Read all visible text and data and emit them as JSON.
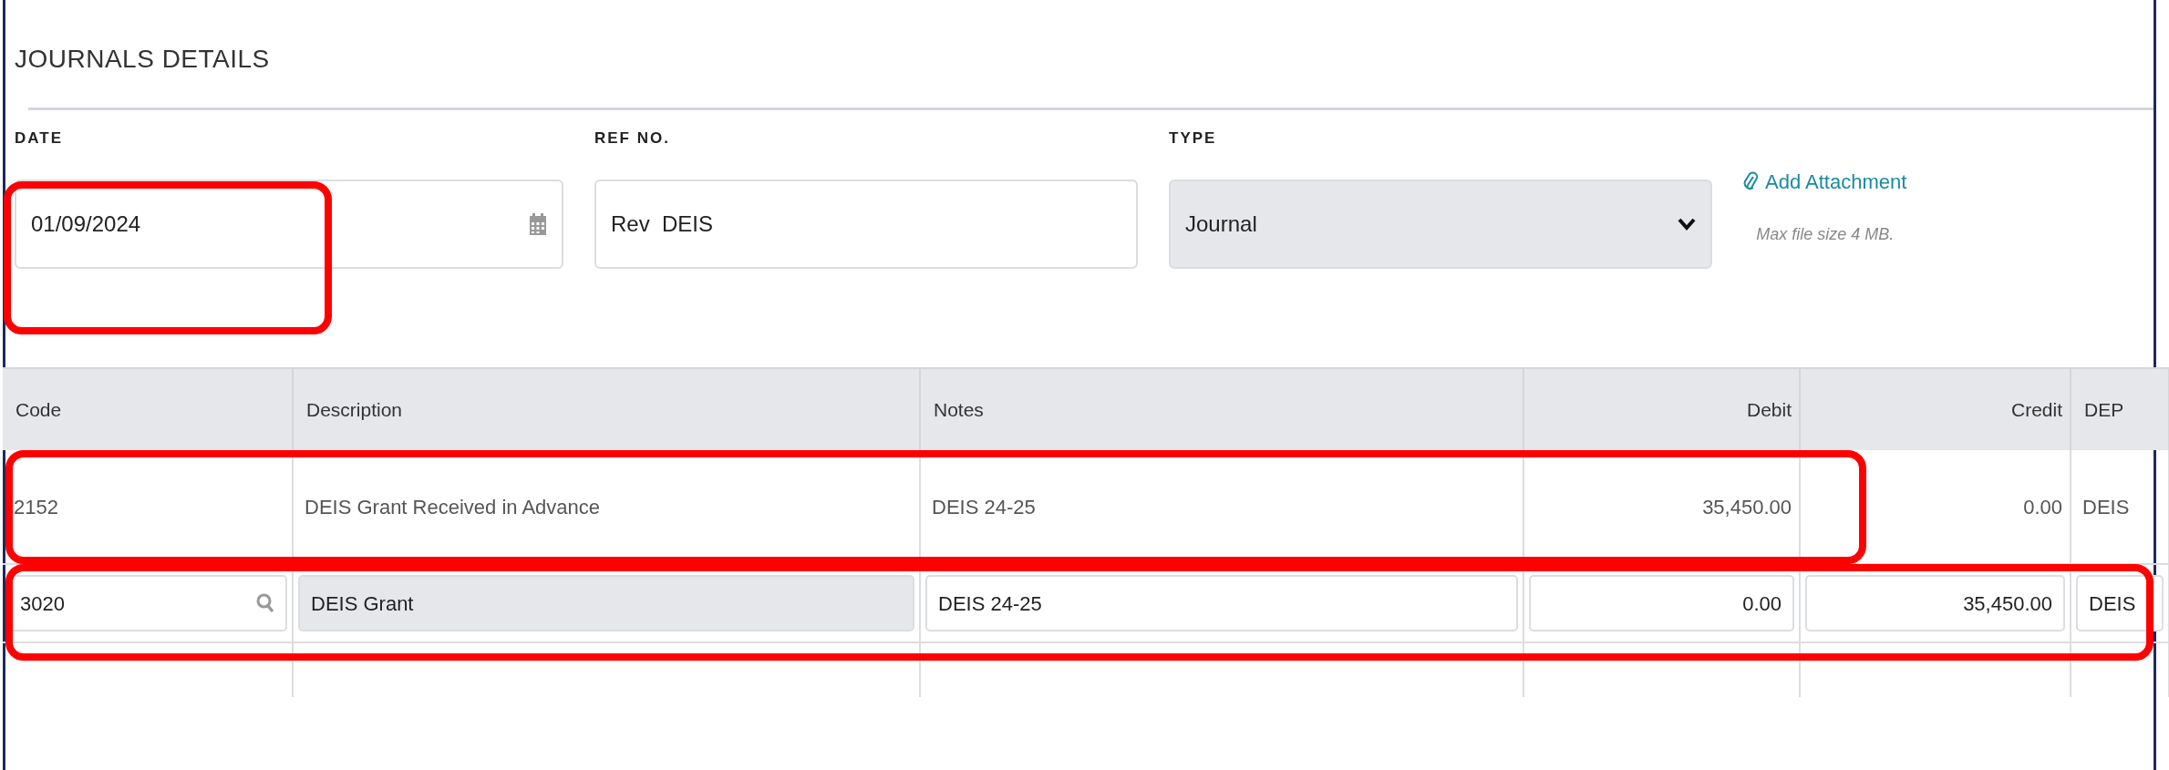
{
  "title": "JOURNALS DETAILS",
  "fields": [
    {
      "kind": "date",
      "label": "DATE",
      "value": "01/09/2024",
      "highlighted": true
    },
    {
      "kind": "text",
      "label": "REF NO.",
      "value": "Rev  DEIS",
      "highlighted": false
    },
    {
      "kind": "select",
      "label": "TYPE",
      "value": "Journal",
      "highlighted": false
    }
  ],
  "attachment": {
    "link": "Add Attachment",
    "hint": "Max file size 4 MB."
  },
  "table": {
    "columns": [
      {
        "label": "Code",
        "kind": "text"
      },
      {
        "label": "Description",
        "kind": "text"
      },
      {
        "label": "Notes",
        "kind": "text"
      },
      {
        "label": "Debit",
        "kind": "amount"
      },
      {
        "label": "Credit",
        "kind": "amount"
      },
      {
        "label": "DEP",
        "kind": "text"
      }
    ],
    "rows": [
      {
        "cells": [
          {
            "kind": "text",
            "text": "2152",
            "highlighted": true
          },
          {
            "kind": "text",
            "text": "DEIS Grant Received in Advance",
            "highlighted": true
          },
          {
            "kind": "text",
            "text": "DEIS 24-25",
            "highlighted": true
          },
          {
            "kind": "text",
            "text": "35,450.00",
            "highlighted": true
          },
          {
            "kind": "text",
            "text": "0.00",
            "highlighted": false
          },
          {
            "kind": "text",
            "text": "DEIS",
            "highlighted": false
          }
        ]
      },
      {
        "cells": [
          {
            "kind": "lookup",
            "text": "3020",
            "highlighted": true
          },
          {
            "kind": "readonly",
            "text": "DEIS Grant",
            "highlighted": true
          },
          {
            "kind": "input",
            "text": "DEIS 24-25",
            "highlighted": true
          },
          {
            "kind": "input",
            "text": "0.00",
            "highlighted": true
          },
          {
            "kind": "input",
            "text": "35,450.00",
            "highlighted": true
          },
          {
            "kind": "input",
            "text": "DEIS",
            "highlighted": true
          }
        ]
      }
    ]
  }
}
